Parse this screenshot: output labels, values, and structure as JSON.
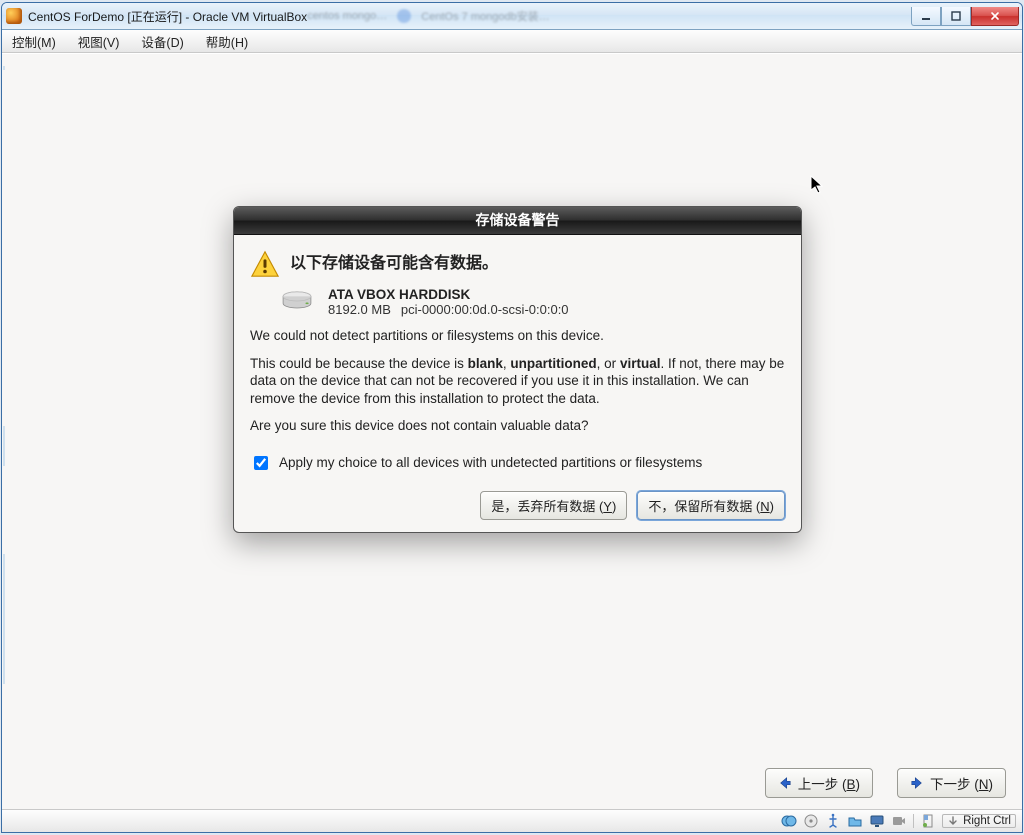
{
  "window": {
    "title": "CentOS ForDemo [正在运行] - Oracle VM VirtualBox"
  },
  "menubar": {
    "control": "控制(M)",
    "view": "视图(V)",
    "devices": "设备(D)",
    "help": "帮助(H)"
  },
  "dialog": {
    "title": "存储设备警告",
    "heading": "以下存储设备可能含有数据。",
    "disk": {
      "name": "ATA VBOX HARDDISK",
      "size": "8192.0 MB",
      "path": "pci-0000:00:0d.0-scsi-0:0:0:0"
    },
    "p1": "We could not detect partitions or filesystems on this device.",
    "p2a": "This could be because the device is ",
    "p2_blank": "blank",
    "p2_sep1": ", ",
    "p2_unpart": "unpartitioned",
    "p2_sep2": ", or ",
    "p2_virtual": "virtual",
    "p2b": ". If not, there may be data on the device that can not be recovered if you use it in this installation. We can remove the device from this installation to protect the data.",
    "p3": "Are you sure this device does not contain valuable data?",
    "checkbox_label": "Apply my choice to all devices with undetected partitions or filesystems",
    "btn_yes_pre": "是，丢弃所有数据 (",
    "btn_yes_key": "Y",
    "btn_yes_post": ")",
    "btn_no_pre": "不，保留所有数据 (",
    "btn_no_key": "N",
    "btn_no_post": ")"
  },
  "nav": {
    "back_pre": "上一步 (",
    "back_key": "B",
    "back_post": ")",
    "next_pre": "下一步 (",
    "next_key": "N",
    "next_post": ")"
  },
  "status": {
    "capture": "Right Ctrl"
  }
}
